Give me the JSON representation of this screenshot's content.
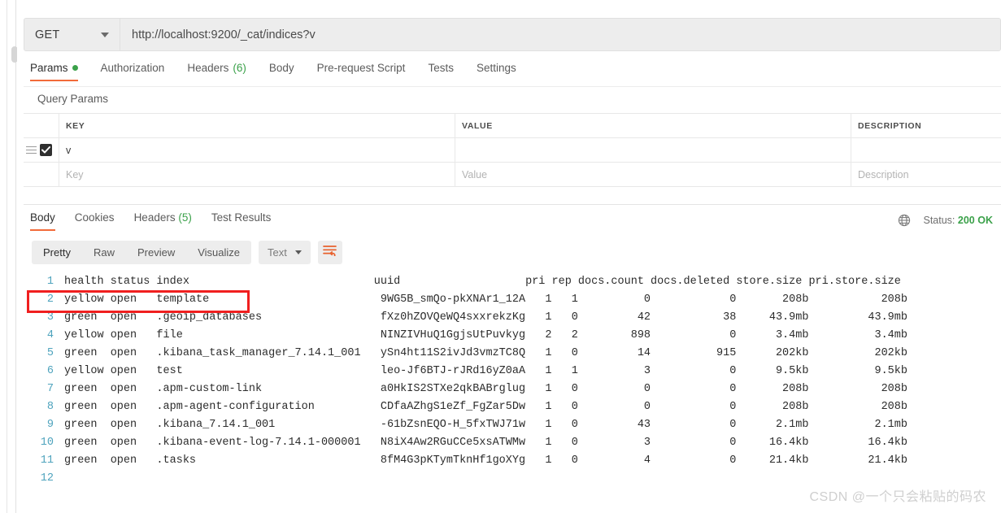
{
  "request": {
    "method": "GET",
    "method_caret_icon": "chevron-down-icon",
    "url": "http://localhost:9200/_cat/indices?v",
    "tabs": [
      {
        "label": "Params",
        "badge_dot": true,
        "active": true
      },
      {
        "label": "Authorization",
        "active": false
      },
      {
        "label": "Headers",
        "count": "(6)",
        "active": false
      },
      {
        "label": "Body",
        "active": false
      },
      {
        "label": "Pre-request Script",
        "active": false
      },
      {
        "label": "Tests",
        "active": false
      },
      {
        "label": "Settings",
        "active": false
      }
    ],
    "section_label": "Query Params",
    "params_table": {
      "headers": [
        "KEY",
        "VALUE",
        "DESCRIPTION"
      ],
      "rows": [
        {
          "checked": true,
          "key": "v",
          "value": "",
          "description": ""
        }
      ],
      "placeholder_row": {
        "key": "Key",
        "value": "Value",
        "description": "Description"
      }
    }
  },
  "response": {
    "tabs": [
      {
        "label": "Body",
        "active": true
      },
      {
        "label": "Cookies",
        "active": false
      },
      {
        "label": "Headers",
        "count": "(5)",
        "active": false
      },
      {
        "label": "Test Results",
        "active": false
      }
    ],
    "status_label": "Status:",
    "status_value": "200 OK",
    "globe_icon": "globe-icon",
    "view_modes": [
      {
        "label": "Pretty",
        "active": true
      },
      {
        "label": "Raw",
        "active": false
      },
      {
        "label": "Preview",
        "active": false
      },
      {
        "label": "Visualize",
        "active": false
      }
    ],
    "format_selected": "Text",
    "format_caret_icon": "chevron-down-icon",
    "wrap_icon": "wrap-text-icon",
    "body_lines": [
      {
        "n": "1",
        "text": "health status index                            uuid                   pri rep docs.count docs.deleted store.size pri.store.size"
      },
      {
        "n": "2",
        "text": "yellow open   template                          9WG5B_smQo-pkXNAr1_12A   1   1          0            0       208b           208b"
      },
      {
        "n": "3",
        "text": "green  open   .geoip_databases                  fXz0hZOVQeWQ4sxxrekzKg   1   0         42           38     43.9mb         43.9mb"
      },
      {
        "n": "4",
        "text": "yellow open   file                              NINZIVHuQ1GgjsUtPuvkyg   2   2        898            0      3.4mb          3.4mb"
      },
      {
        "n": "5",
        "text": "green  open   .kibana_task_manager_7.14.1_001   ySn4ht11S2ivJd3vmzTC8Q   1   0         14          915      202kb          202kb"
      },
      {
        "n": "6",
        "text": "yellow open   test                              leo-Jf6BTJ-rJRd16yZ0aA   1   1          3            0      9.5kb          9.5kb"
      },
      {
        "n": "7",
        "text": "green  open   .apm-custom-link                  a0HkIS2STXe2qkBABrglug   1   0          0            0       208b           208b"
      },
      {
        "n": "8",
        "text": "green  open   .apm-agent-configuration          CDfaAZhgS1eZf_FgZar5Dw   1   0          0            0       208b           208b"
      },
      {
        "n": "9",
        "text": "green  open   .kibana_7.14.1_001                -61bZsnEQO-H_5fxTWJ71w   1   0         43            0      2.1mb          2.1mb"
      },
      {
        "n": "10",
        "text": "green  open   .kibana-event-log-7.14.1-000001   N8iX4Aw2RGuCCe5xsATWMw   1   0          3            0     16.4kb         16.4kb"
      },
      {
        "n": "11",
        "text": "green  open   .tasks                            8fM4G3pKTymTknHf1goXYg   1   0          4            0     21.4kb         21.4kb"
      },
      {
        "n": "12",
        "text": ""
      }
    ]
  },
  "annotation": {
    "highlight_color": "#f01f1f",
    "highlighted_line": "2"
  },
  "watermark": "CSDN @一个只会粘贴的码农",
  "colors": {
    "accent": "#f26b3a",
    "success": "#3ba14a",
    "line_number": "#4ea3bd"
  }
}
